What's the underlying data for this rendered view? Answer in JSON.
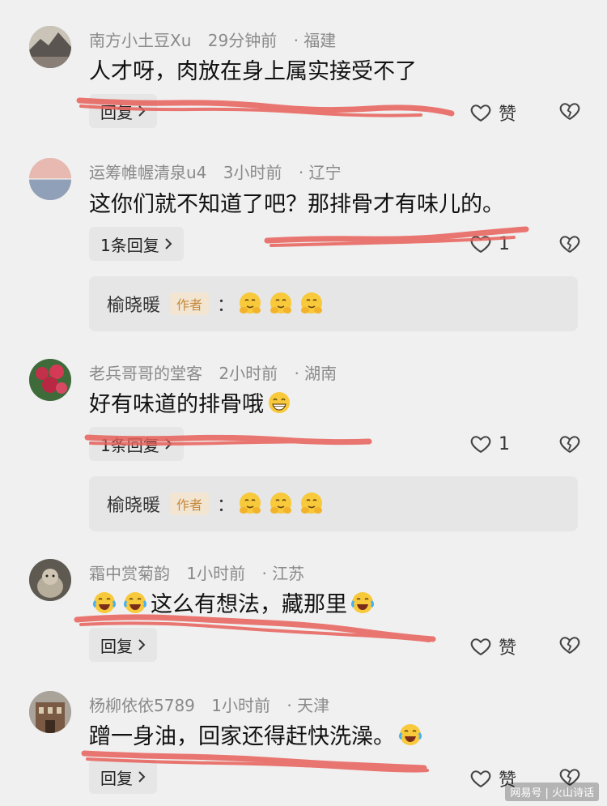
{
  "comments": [
    {
      "username": "南方小土豆Xu",
      "time": "29分钟前",
      "location": "· 福建",
      "text": "人才呀，肉放在身上属实接受不了",
      "reply_label": "回复",
      "like_label": "赞"
    },
    {
      "username": "运筹帷幄清泉u4",
      "time": "3小时前",
      "location": "· 辽宁",
      "text": "这你们就不知道了吧？那排骨才有味儿的。",
      "reply_label": "1条回复",
      "like_label": "1",
      "sub_reply": {
        "author": "榆晓暖",
        "tag": "作者",
        "colon": "："
      }
    },
    {
      "username": "老兵哥哥的堂客",
      "time": "2小时前",
      "location": "· 湖南",
      "text": "好有味道的排骨哦",
      "reply_label": "1条回复",
      "like_label": "1",
      "sub_reply": {
        "author": "榆晓暖",
        "tag": "作者",
        "colon": "："
      }
    },
    {
      "username": "霜中赏菊韵",
      "time": "1小时前",
      "location": "· 江苏",
      "text": "这么有想法，藏那里",
      "reply_label": "回复",
      "like_label": "赞"
    },
    {
      "username": "杨柳依依5789",
      "time": "1小时前",
      "location": "· 天津",
      "text": "蹭一身油，回家还得赶快洗澡。",
      "reply_label": "回复",
      "like_label": "赞"
    }
  ],
  "icons": {
    "heart": "heart-icon",
    "broken_heart": "broken-heart-icon",
    "chevron": "chevron-right-icon",
    "emoji_hug": "hug-emoji-icon",
    "emoji_laugh": "laugh-cry-emoji-icon",
    "emoji_grin": "grin-emoji-icon"
  },
  "colors": {
    "background": "#f0f0f0",
    "author_tag_bg": "#f2e6d3",
    "author_tag_text": "#c8893d",
    "scribble": "#e8605a"
  },
  "watermark": "网易号 | 火山诗话"
}
